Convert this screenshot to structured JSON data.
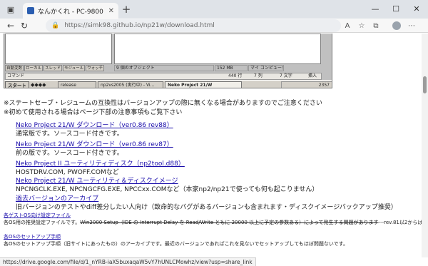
{
  "browser": {
    "tab_title": "なんかくれ - PC-9800 Series Emulator",
    "url": "https://simk98.github.io/np21w/download.html",
    "hover_url": "https://drive.google.com/file/d/1_nYRB-iaX5buxaqaW5vY7hUNLCMowhz/view?usp=share_link"
  },
  "screenshot": {
    "status_objects": "9 個のオブジェクト",
    "status_size": "152 MB",
    "status_computer": "マイ コンピュータ",
    "left_tabs": [
      "自動変数",
      "ローカル",
      "スレッド",
      "モジュール",
      "ウォッチ"
    ],
    "command_label": "コマンド",
    "line": "440 行",
    "column": "7 列",
    "chars": "7 文字",
    "mode": "挿入",
    "start": "スタート",
    "task1": "release",
    "task2": "np2vs2005 (実行中) - Vi...",
    "task3": "Neko Project 21/W",
    "clock": "2357"
  },
  "notices": [
    "※ステートセーブ・レジュームの互換性はバージョンアップの際に無くなる場合がありますのでご注意ください",
    "※初めて使用される場合はページ下部の注意事項もご覧下さい"
  ],
  "downloads": [
    {
      "link": "Neko Project 21/W ダウンロード（ver0.86 rev88）",
      "desc": "通常版です。ソースコード付きです。"
    },
    {
      "link": "Neko Project 21/W ダウンロード（ver0.86 rev87）",
      "desc": "前の版です。ソースコード付きです。"
    },
    {
      "link": "Neko Project II ユーティリティディスク（np2tool.d88）",
      "desc": "HOSTDRV.COM, PWOFF.COMなど"
    },
    {
      "link": "Neko Project 21/W ユーティリティ＆ディスクイメージ",
      "desc": "NPCNGCLK.EXE, NPCNGCFG.EXE, NPCCxx.COMなど（本家np2/np21で使っても何も起こりません）"
    },
    {
      "link": "過去バージョンのアーカイブ",
      "desc": "旧バージョンのテストやdiff差分したい人向け（致命的なバグがあるバージョンも含まれます・ディスクイメージバックアップ推奨）"
    }
  ],
  "small_links": [
    {
      "link": "各ゲストOS向け設定ファイル",
      "desc_prefix": "各OS用の推奨設定ファイルです。",
      "desc_struck": "Win2000 Setup（IDE の Interrupt Delay を Read/Write ともに 20000 以上に予定の参数ある）によって発生する問題があります",
      "desc_suffix": "---rev.81以2からはWin2000 Setupでのディレイ設定不要です。"
    },
    {
      "link": "各OSのセットアップ手順",
      "desc": "各OSのセットアップ手順（旧サイトにあったもの）のアーカイブです。最近のバージョンであればこれを見ないでセットアップしてもほぼ問題ないです。"
    }
  ]
}
